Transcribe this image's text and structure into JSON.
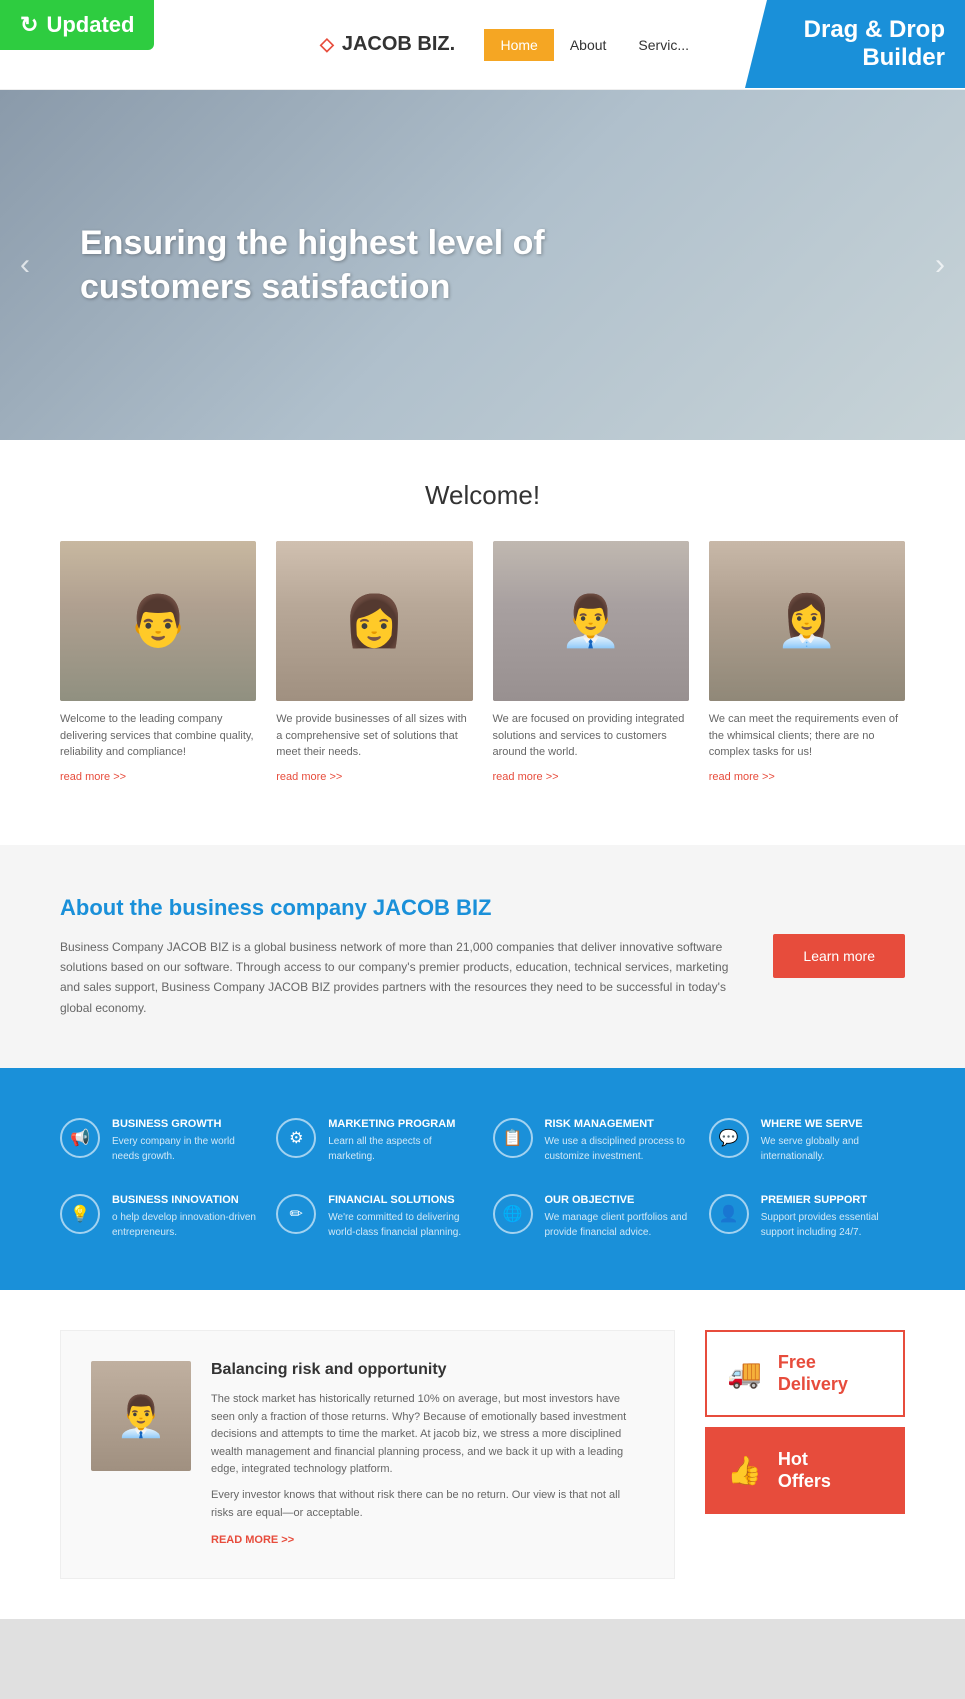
{
  "updated_badge": {
    "label": "Updated",
    "icon": "↻"
  },
  "drag_drop_badge": {
    "line1": "Drag & Drop",
    "line2": "Builder",
    "icon": "↗"
  },
  "header": {
    "logo_text": "JACOB BIZ.",
    "diamond_icon": "◇",
    "nav_items": [
      {
        "label": "Home",
        "active": true
      },
      {
        "label": "About",
        "active": false
      },
      {
        "label": "Servic...",
        "active": false
      }
    ]
  },
  "hero": {
    "headline": "Ensuring the highest level of customers satisfaction",
    "prev_arrow": "‹",
    "next_arrow": "›"
  },
  "welcome": {
    "title": "Welcome!",
    "team": [
      {
        "description": "Welcome to the leading company delivering services that combine quality, reliability and compliance!",
        "link": "read more >>"
      },
      {
        "description": "We provide businesses of all sizes with a comprehensive set of solutions that meet their needs.",
        "link": "read more >>"
      },
      {
        "description": "We are focused on providing integrated solutions and services to customers around the world.",
        "link": "read more >>"
      },
      {
        "description": "We can meet the requirements even of the whimsical clients; there are no complex tasks for us!",
        "link": "read more >>"
      }
    ]
  },
  "about": {
    "title": "About the business company JACOB BIZ",
    "description": "Business Company JACOB BIZ is a global business network of more than 21,000 companies that deliver innovative software solutions based on our software. Through access to our company's premier products, education, technical services, marketing and sales support, Business Company JACOB BIZ provides partners with the resources they need to be successful in today's global economy.",
    "button_label": "Learn more"
  },
  "features": [
    {
      "icon": "📢",
      "title": "BUSINESS GROWTH",
      "description": "Every company in the world needs growth."
    },
    {
      "icon": "⚙",
      "title": "MARKETING PROGRAM",
      "description": "Learn all the aspects of marketing."
    },
    {
      "icon": "📋",
      "title": "RISK MANAGEMENT",
      "description": "We use a disciplined process to customize investment."
    },
    {
      "icon": "💬",
      "title": "WHERE WE SERVE",
      "description": "We serve globally and internationally."
    },
    {
      "icon": "💡",
      "title": "BUSINESS INNOVATION",
      "description": "o help develop innovation-driven entrepreneurs."
    },
    {
      "icon": "✏",
      "title": "FINANCIAL SOLUTIONS",
      "description": "We're committed to delivering world-class financial planning."
    },
    {
      "icon": "🌐",
      "title": "OUR OBJECTIVE",
      "description": "We manage client portfolios and provide financial advice."
    },
    {
      "icon": "👤",
      "title": "PREMIER SUPPORT",
      "description": "Support provides essential support including 24/7."
    }
  ],
  "balance_card": {
    "title": "Balancing risk and opportunity",
    "paragraphs": [
      "The stock market has historically returned 10% on average, but most investors have seen only a fraction of those returns. Why? Because of emotionally based investment decisions and attempts to time the market. At jacob biz, we stress a more disciplined wealth management and financial planning process, and we back it up with a leading edge, integrated technology platform.",
      "Every investor knows that without risk there can be no return. Our view is that not all risks are equal—or acceptable."
    ],
    "link": "READ MORE >>"
  },
  "side_offers": [
    {
      "icon": "🚚",
      "line1": "Free",
      "line2": "Delivery",
      "red_bg": false
    },
    {
      "icon": "👍",
      "line1": "Hot",
      "line2": "Offers",
      "red_bg": true
    }
  ]
}
